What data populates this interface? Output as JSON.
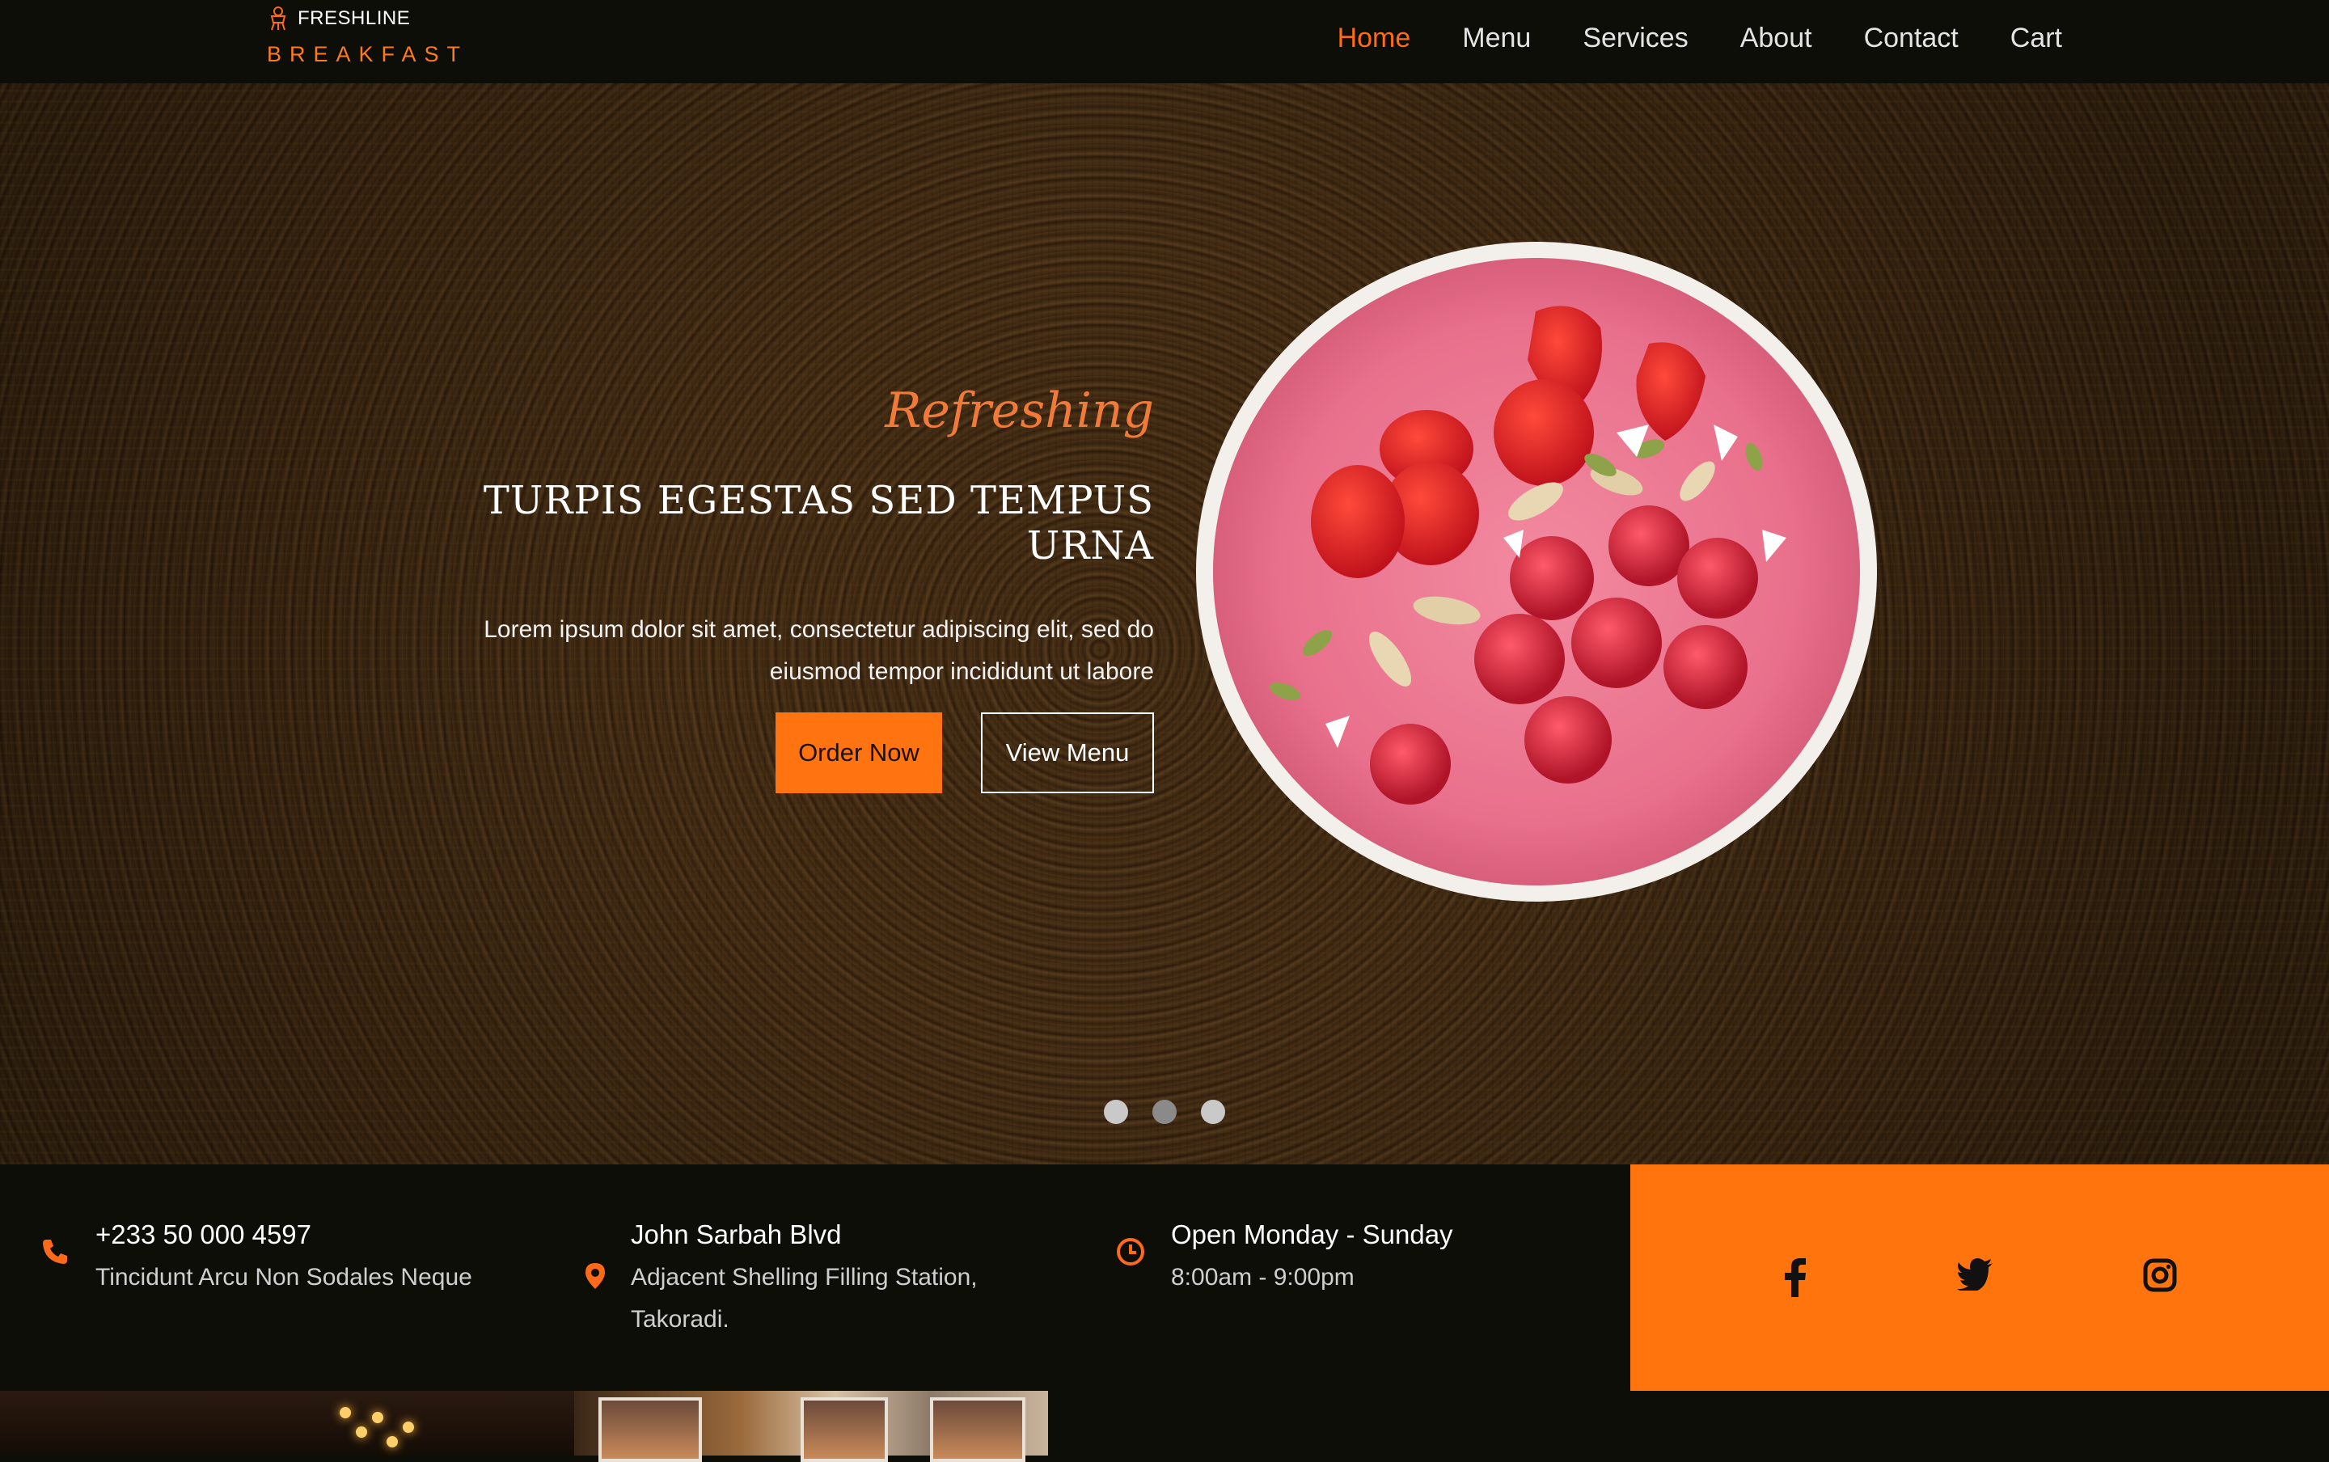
{
  "header": {
    "logo_name": "FRESHLINE",
    "logo_sub": "BREAKFAST",
    "nav": [
      {
        "label": "Home",
        "active": true
      },
      {
        "label": "Menu",
        "active": false
      },
      {
        "label": "Services",
        "active": false
      },
      {
        "label": "About",
        "active": false
      },
      {
        "label": "Contact",
        "active": false
      },
      {
        "label": "Cart",
        "active": false
      }
    ]
  },
  "hero": {
    "script": "Refreshing",
    "title": "TURPIS EGESTAS SED TEMPUS URNA",
    "description": "Lorem ipsum dolor sit amet, consectetur adipiscing elit, sed do eiusmod tempor incididunt ut labore",
    "order_button": "Order Now",
    "menu_button": "View Menu",
    "slides": 3,
    "active_slide": 2
  },
  "info": {
    "phone": {
      "title": "+233 50 000 4597",
      "text": "Tincidunt Arcu Non Sodales Neque",
      "icon": "phone-icon"
    },
    "address": {
      "title": "John Sarbah Blvd",
      "text": "Adjacent Shelling Filling Station, Takoradi.",
      "icon": "map-pin-icon"
    },
    "hours": {
      "title": "Open Monday - Sunday",
      "text": "8:00am - 9:00pm",
      "icon": "clock-icon"
    }
  },
  "social": [
    "facebook-icon",
    "twitter-icon",
    "instagram-icon"
  ],
  "colors": {
    "accent": "#ff7310",
    "background": "#0c0e07",
    "nav_active": "#ff6a1a",
    "social_bar": "#ff740c"
  }
}
